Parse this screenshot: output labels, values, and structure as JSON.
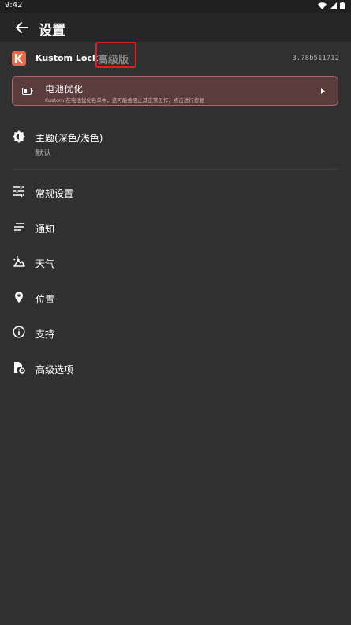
{
  "status_bar": {
    "time": "9:42"
  },
  "app_bar": {
    "title": "设置"
  },
  "brand": {
    "name": "Kustom Lock",
    "pro_label": "高级版",
    "version": "3.78b511712"
  },
  "battery_card": {
    "title": "电池优化",
    "description": "Kustom 在电池优化名单中，这可能会阻止其正常工作，点击进行修复"
  },
  "theme": {
    "title": "主题(深色/浅色)",
    "value": "默认"
  },
  "menu": [
    {
      "label": "常规设置",
      "icon": "sliders-icon"
    },
    {
      "label": "通知",
      "icon": "notes-icon"
    },
    {
      "label": "天气",
      "icon": "weather-icon"
    },
    {
      "label": "位置",
      "icon": "location-pin-icon"
    },
    {
      "label": "支持",
      "icon": "info-icon"
    },
    {
      "label": "高级选项",
      "icon": "file-settings-icon"
    }
  ],
  "colors": {
    "background": "#303030",
    "app_bar": "#262626",
    "logo_accent": "#e8694a",
    "battery_card_bg": "#5a3c3c",
    "highlight_box": "#e02020"
  }
}
